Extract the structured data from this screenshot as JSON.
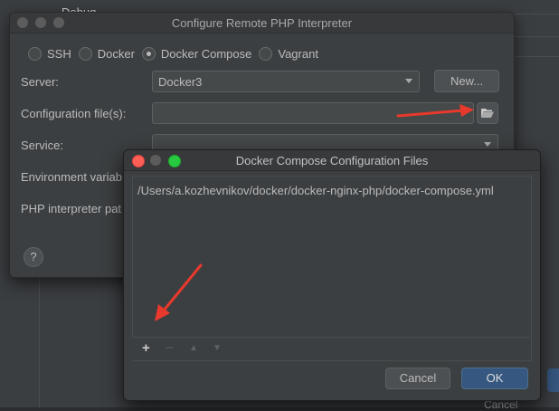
{
  "background": {
    "partial_title": "Debug...",
    "cancel_label": "Cancel"
  },
  "configure_dialog": {
    "title": "Configure Remote PHP Interpreter",
    "radios": [
      "SSH",
      "Docker",
      "Docker Compose",
      "Vagrant"
    ],
    "selected_radio": "Docker Compose",
    "server_label": "Server:",
    "server_value": "Docker3",
    "new_button": "New...",
    "config_files_label": "Configuration file(s):",
    "config_files_value": "",
    "service_label": "Service:",
    "service_value": "",
    "env_label": "Environment variab",
    "php_path_label": "PHP interpreter pat",
    "help_label": "?"
  },
  "compose_dialog": {
    "title": "Docker Compose Configuration Files",
    "files": [
      "/Users/a.kozhevnikov/docker/docker-nginx-php/docker-compose.yml"
    ],
    "toolbar": {
      "add": "+",
      "remove": "−",
      "up": "▲",
      "down": "▼"
    },
    "cancel_label": "Cancel",
    "ok_label": "OK"
  },
  "colors": {
    "accent": "#365880",
    "annotation_arrow": "#e8392c"
  }
}
